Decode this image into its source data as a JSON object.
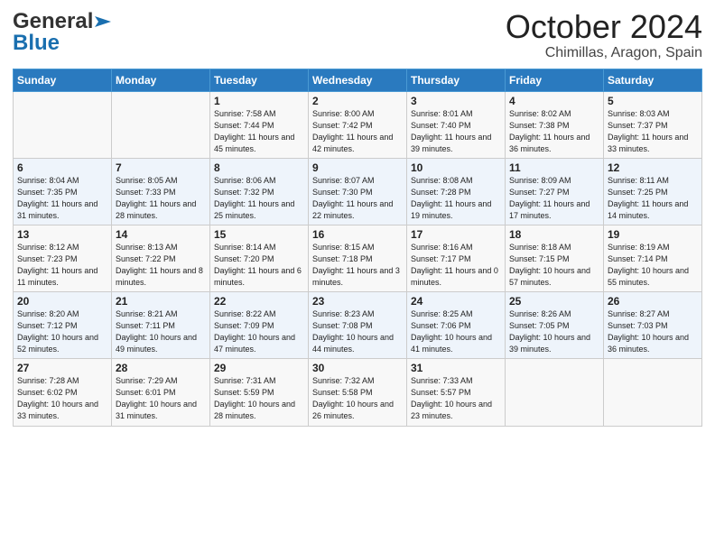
{
  "header": {
    "logo_general": "General",
    "logo_blue": "Blue",
    "month": "October 2024",
    "location": "Chimillas, Aragon, Spain"
  },
  "days_of_week": [
    "Sunday",
    "Monday",
    "Tuesday",
    "Wednesday",
    "Thursday",
    "Friday",
    "Saturday"
  ],
  "weeks": [
    [
      {
        "day": "",
        "info": ""
      },
      {
        "day": "",
        "info": ""
      },
      {
        "day": "1",
        "info": "Sunrise: 7:58 AM\nSunset: 7:44 PM\nDaylight: 11 hours and 45 minutes."
      },
      {
        "day": "2",
        "info": "Sunrise: 8:00 AM\nSunset: 7:42 PM\nDaylight: 11 hours and 42 minutes."
      },
      {
        "day": "3",
        "info": "Sunrise: 8:01 AM\nSunset: 7:40 PM\nDaylight: 11 hours and 39 minutes."
      },
      {
        "day": "4",
        "info": "Sunrise: 8:02 AM\nSunset: 7:38 PM\nDaylight: 11 hours and 36 minutes."
      },
      {
        "day": "5",
        "info": "Sunrise: 8:03 AM\nSunset: 7:37 PM\nDaylight: 11 hours and 33 minutes."
      }
    ],
    [
      {
        "day": "6",
        "info": "Sunrise: 8:04 AM\nSunset: 7:35 PM\nDaylight: 11 hours and 31 minutes."
      },
      {
        "day": "7",
        "info": "Sunrise: 8:05 AM\nSunset: 7:33 PM\nDaylight: 11 hours and 28 minutes."
      },
      {
        "day": "8",
        "info": "Sunrise: 8:06 AM\nSunset: 7:32 PM\nDaylight: 11 hours and 25 minutes."
      },
      {
        "day": "9",
        "info": "Sunrise: 8:07 AM\nSunset: 7:30 PM\nDaylight: 11 hours and 22 minutes."
      },
      {
        "day": "10",
        "info": "Sunrise: 8:08 AM\nSunset: 7:28 PM\nDaylight: 11 hours and 19 minutes."
      },
      {
        "day": "11",
        "info": "Sunrise: 8:09 AM\nSunset: 7:27 PM\nDaylight: 11 hours and 17 minutes."
      },
      {
        "day": "12",
        "info": "Sunrise: 8:11 AM\nSunset: 7:25 PM\nDaylight: 11 hours and 14 minutes."
      }
    ],
    [
      {
        "day": "13",
        "info": "Sunrise: 8:12 AM\nSunset: 7:23 PM\nDaylight: 11 hours and 11 minutes."
      },
      {
        "day": "14",
        "info": "Sunrise: 8:13 AM\nSunset: 7:22 PM\nDaylight: 11 hours and 8 minutes."
      },
      {
        "day": "15",
        "info": "Sunrise: 8:14 AM\nSunset: 7:20 PM\nDaylight: 11 hours and 6 minutes."
      },
      {
        "day": "16",
        "info": "Sunrise: 8:15 AM\nSunset: 7:18 PM\nDaylight: 11 hours and 3 minutes."
      },
      {
        "day": "17",
        "info": "Sunrise: 8:16 AM\nSunset: 7:17 PM\nDaylight: 11 hours and 0 minutes."
      },
      {
        "day": "18",
        "info": "Sunrise: 8:18 AM\nSunset: 7:15 PM\nDaylight: 10 hours and 57 minutes."
      },
      {
        "day": "19",
        "info": "Sunrise: 8:19 AM\nSunset: 7:14 PM\nDaylight: 10 hours and 55 minutes."
      }
    ],
    [
      {
        "day": "20",
        "info": "Sunrise: 8:20 AM\nSunset: 7:12 PM\nDaylight: 10 hours and 52 minutes."
      },
      {
        "day": "21",
        "info": "Sunrise: 8:21 AM\nSunset: 7:11 PM\nDaylight: 10 hours and 49 minutes."
      },
      {
        "day": "22",
        "info": "Sunrise: 8:22 AM\nSunset: 7:09 PM\nDaylight: 10 hours and 47 minutes."
      },
      {
        "day": "23",
        "info": "Sunrise: 8:23 AM\nSunset: 7:08 PM\nDaylight: 10 hours and 44 minutes."
      },
      {
        "day": "24",
        "info": "Sunrise: 8:25 AM\nSunset: 7:06 PM\nDaylight: 10 hours and 41 minutes."
      },
      {
        "day": "25",
        "info": "Sunrise: 8:26 AM\nSunset: 7:05 PM\nDaylight: 10 hours and 39 minutes."
      },
      {
        "day": "26",
        "info": "Sunrise: 8:27 AM\nSunset: 7:03 PM\nDaylight: 10 hours and 36 minutes."
      }
    ],
    [
      {
        "day": "27",
        "info": "Sunrise: 7:28 AM\nSunset: 6:02 PM\nDaylight: 10 hours and 33 minutes."
      },
      {
        "day": "28",
        "info": "Sunrise: 7:29 AM\nSunset: 6:01 PM\nDaylight: 10 hours and 31 minutes."
      },
      {
        "day": "29",
        "info": "Sunrise: 7:31 AM\nSunset: 5:59 PM\nDaylight: 10 hours and 28 minutes."
      },
      {
        "day": "30",
        "info": "Sunrise: 7:32 AM\nSunset: 5:58 PM\nDaylight: 10 hours and 26 minutes."
      },
      {
        "day": "31",
        "info": "Sunrise: 7:33 AM\nSunset: 5:57 PM\nDaylight: 10 hours and 23 minutes."
      },
      {
        "day": "",
        "info": ""
      },
      {
        "day": "",
        "info": ""
      }
    ]
  ]
}
